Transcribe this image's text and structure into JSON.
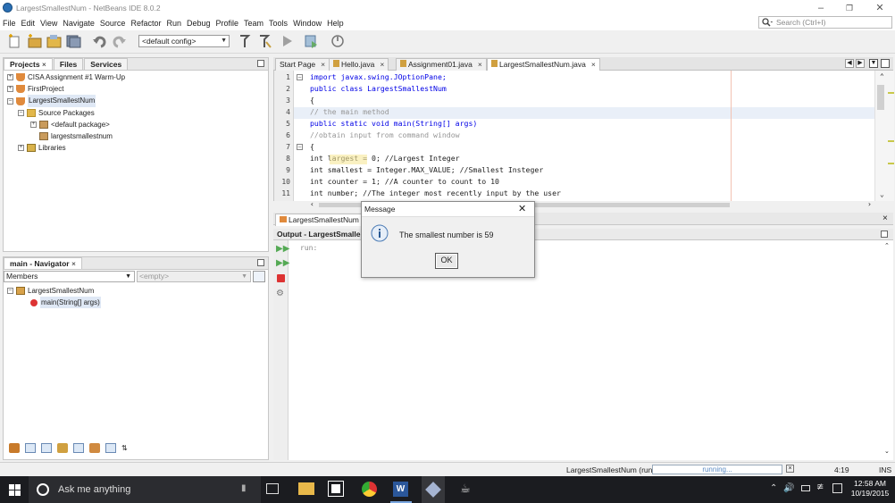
{
  "window": {
    "title": "LargestSmallestNum - NetBeans IDE 8.0.2"
  },
  "menu": [
    "File",
    "Edit",
    "View",
    "Navigate",
    "Source",
    "Refactor",
    "Run",
    "Debug",
    "Profile",
    "Team",
    "Tools",
    "Window",
    "Help"
  ],
  "search": {
    "placeholder": "Search (Ctrl+I)"
  },
  "toolbar": {
    "config": "<default config>"
  },
  "projects_panel": {
    "tabs": [
      "Projects",
      "Files",
      "Services"
    ],
    "tree": [
      {
        "label": "CISA Assignment #1 Warm-Up",
        "icon": "project-icon"
      },
      {
        "label": "FirstProject",
        "icon": "project-icon"
      },
      {
        "label": "LargestSmallestNum",
        "icon": "project-icon"
      },
      {
        "label": "Source Packages",
        "icon": "folder-icon"
      },
      {
        "label": "<default package>",
        "icon": "package-icon"
      },
      {
        "label": "largestsmallestnum",
        "icon": "package-icon"
      },
      {
        "label": "Libraries",
        "icon": "library-icon"
      }
    ]
  },
  "navigator": {
    "title": "main - Navigator",
    "members_label": "Members",
    "filter_placeholder": "<empty>",
    "tree": [
      {
        "label": "LargestSmallestNum",
        "icon": "class-icon"
      },
      {
        "label": "main(String[] args)",
        "icon": "method-icon"
      }
    ]
  },
  "editor": {
    "tabs": [
      "Start Page",
      "Hello.java",
      "Assignment01.java",
      "LargestSmallestNum.java"
    ],
    "active_tab": "LargestSmallestNum.java",
    "line_numbers": [
      "1",
      "2",
      "3",
      "4",
      "5",
      "6",
      "7",
      "8",
      "9",
      "10",
      "11"
    ],
    "lines": [
      "import javax.swing.JOptionPane;",
      "public class LargestSmallestNum",
      "{",
      "// the main method",
      "public static void main(String[] args)",
      "//obtain input from command window",
      "{",
      "int largest = 0; //Largest Integer",
      "int smallest = Integer.MAX_VALUE; //Smallest Insteger",
      "int counter = 1; //A counter to count to 10",
      "int number; //The integer most recently input by the user"
    ]
  },
  "output": {
    "tab": "LargestSmallestNum",
    "header": "Output - LargestSmalle",
    "text": "run:"
  },
  "dialog": {
    "title": "Message",
    "message": "The smallest number is 59",
    "ok": "OK"
  },
  "statusbar": {
    "task": "LargestSmallestNum (run)",
    "progress": "running...",
    "position": "4:19",
    "mode": "INS"
  },
  "taskbar": {
    "search_placeholder": "Ask me anything",
    "time": "12:58 AM",
    "date": "10/19/2015"
  }
}
